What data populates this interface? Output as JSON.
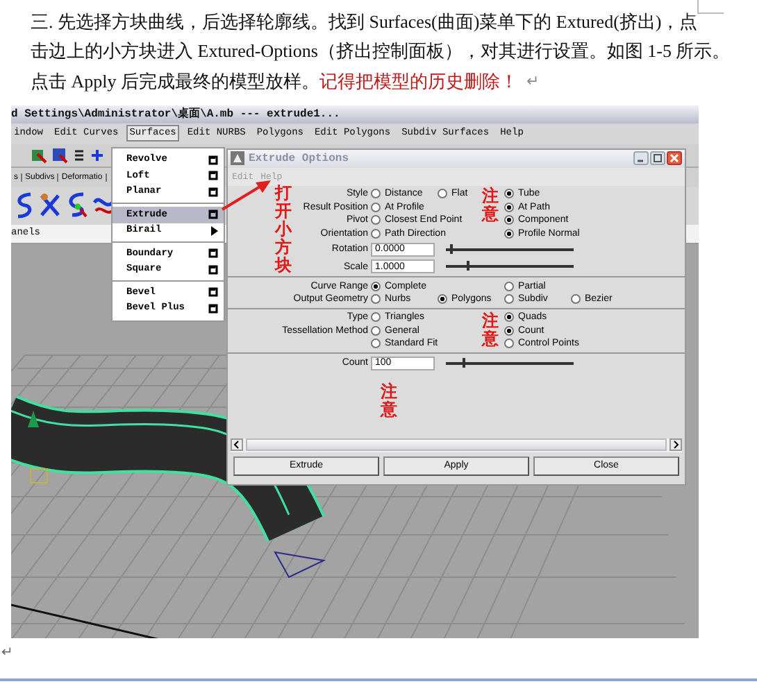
{
  "document": {
    "lines": [
      "三.  先选择方块曲线，后选择轮廓线。找到 Surfaces(曲面)菜单下的 Extured(挤出)，点",
      "击边上的小方块进入 Extured-Options（挤出控制面板），对其进行设置。如图 1-5 所示。",
      "点击 Apply 后完成最终的模型放样。"
    ],
    "warning": "记得把模型的历史删除！",
    "paragraph_mark": "↵",
    "end_mark": "↵"
  },
  "maya": {
    "title": "d Settings\\Administrator\\桌面\\A.mb   ---   extrude1...",
    "menu": [
      {
        "label": "indow",
        "selected": false
      },
      {
        "label": "Edit Curves",
        "selected": false
      },
      {
        "label": "Surfaces",
        "selected": true
      },
      {
        "label": "Edit NURBS",
        "selected": false
      },
      {
        "label": "Polygons",
        "selected": false
      },
      {
        "label": "Edit Polygons",
        "selected": false
      },
      {
        "label": "Subdiv Surfaces",
        "selected": false
      },
      {
        "label": "Help",
        "selected": false
      }
    ],
    "shelf_tabs": [
      "s",
      "Subdivs",
      "Deformatio"
    ],
    "panel_menu": "anels",
    "surfaces_menu": [
      [
        {
          "label": "Revolve",
          "kind": "option",
          "selected": false
        },
        {
          "label": "Loft",
          "kind": "option",
          "selected": false
        },
        {
          "label": "Planar",
          "kind": "option",
          "selected": false
        }
      ],
      [
        {
          "label": "Extrude",
          "kind": "option",
          "selected": true
        },
        {
          "label": "Birail",
          "kind": "submenu",
          "selected": false
        }
      ],
      [
        {
          "label": "Boundary",
          "kind": "option",
          "selected": false
        },
        {
          "label": "Square",
          "kind": "option",
          "selected": false
        }
      ],
      [
        {
          "label": "Bevel",
          "kind": "option",
          "selected": false
        },
        {
          "label": "Bevel Plus",
          "kind": "option",
          "selected": false
        }
      ]
    ]
  },
  "dialog": {
    "title": "Extrude Options",
    "menu": [
      "Edit",
      "Help"
    ],
    "sections": [
      {
        "rows": [
          {
            "kind": "radio",
            "label": "Style",
            "left": [
              {
                "label": "Distance",
                "selected": false
              },
              {
                "label": "Flat",
                "selected": false
              }
            ],
            "right": [
              {
                "label": "Tube",
                "selected": true
              }
            ]
          },
          {
            "kind": "radio",
            "label": "Result Position",
            "left": [
              {
                "label": "At Profile",
                "selected": false
              }
            ],
            "right": [
              {
                "label": "At Path",
                "selected": true
              }
            ]
          },
          {
            "kind": "radio",
            "label": "Pivot",
            "left": [
              {
                "label": "Closest End Point",
                "selected": false
              }
            ],
            "right": [
              {
                "label": "Component",
                "selected": true
              }
            ]
          },
          {
            "kind": "radio",
            "label": "Orientation",
            "left": [
              {
                "label": "Path Direction",
                "selected": false
              }
            ],
            "right": [
              {
                "label": "Profile Normal",
                "selected": true
              }
            ]
          },
          {
            "kind": "slider",
            "label": "Rotation",
            "value": "0.0000",
            "level": 0.03
          },
          {
            "kind": "slider",
            "label": "Scale",
            "value": "1.0000",
            "level": 0.16
          }
        ]
      },
      {
        "rows": [
          {
            "kind": "radio",
            "label": "Curve Range",
            "left": [
              {
                "label": "Complete",
                "selected": true
              }
            ],
            "right": [
              {
                "label": "Partial",
                "selected": false
              }
            ]
          },
          {
            "kind": "radio",
            "label": "Output Geometry",
            "left": [
              {
                "label": "Nurbs",
                "selected": false
              },
              {
                "label": "Polygons",
                "selected": true
              }
            ],
            "right": [
              {
                "label": "Subdiv",
                "selected": false
              },
              {
                "label": "Bezier",
                "selected": false
              }
            ]
          }
        ]
      },
      {
        "rows": [
          {
            "kind": "radio",
            "label": "Type",
            "left": [
              {
                "label": "Triangles",
                "selected": false
              }
            ],
            "right": [
              {
                "label": "Quads",
                "selected": true
              }
            ]
          },
          {
            "kind": "radio",
            "label": "Tessellation Method",
            "left": [
              {
                "label": "General",
                "selected": false
              }
            ],
            "right": [
              {
                "label": "Count",
                "selected": true
              }
            ]
          },
          {
            "kind": "radio",
            "left": [
              {
                "label": "Standard Fit",
                "selected": false
              }
            ],
            "right": [
              {
                "label": "Control Points",
                "selected": false
              }
            ]
          }
        ]
      },
      {
        "rows": [
          {
            "kind": "slider",
            "label": "Count",
            "value": "100",
            "level": 0.13
          }
        ]
      }
    ],
    "buttons": [
      "Extrude",
      "Apply",
      "Close"
    ]
  },
  "annotations": {
    "open_box": "打开小方块",
    "notes": [
      "注意",
      "注意",
      "注意"
    ]
  }
}
